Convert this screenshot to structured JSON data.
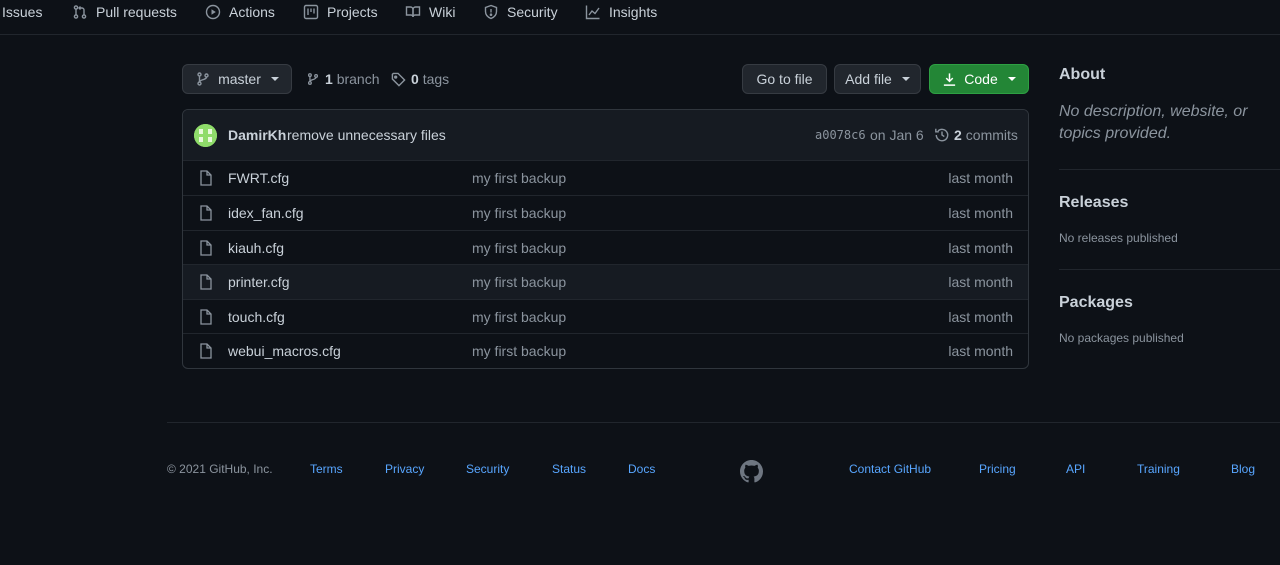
{
  "nav": {
    "items": [
      {
        "label": "Issues",
        "icon": "issues-icon"
      },
      {
        "label": "Pull requests",
        "icon": "pull-request-icon"
      },
      {
        "label": "Actions",
        "icon": "play-icon"
      },
      {
        "label": "Projects",
        "icon": "project-icon"
      },
      {
        "label": "Wiki",
        "icon": "book-icon"
      },
      {
        "label": "Security",
        "icon": "shield-icon"
      },
      {
        "label": "Insights",
        "icon": "graph-icon"
      }
    ]
  },
  "repo": {
    "branch_button": "master",
    "branch_count": "1",
    "branch_label": "branch",
    "tag_count": "0",
    "tag_label": "tags",
    "go_to_file": "Go to file",
    "add_file": "Add file",
    "code": "Code"
  },
  "commit": {
    "author": "DamirKh",
    "message": "remove unnecessary files",
    "sha": "a0078c6",
    "date": "on Jan 6",
    "count": "2",
    "count_label": "commits"
  },
  "files": [
    {
      "name": "FWRT.cfg",
      "message": "my first backup",
      "age": "last month"
    },
    {
      "name": "idex_fan.cfg",
      "message": "my first backup",
      "age": "last month"
    },
    {
      "name": "kiauh.cfg",
      "message": "my first backup",
      "age": "last month"
    },
    {
      "name": "printer.cfg",
      "message": "my first backup",
      "age": "last month"
    },
    {
      "name": "touch.cfg",
      "message": "my first backup",
      "age": "last month"
    },
    {
      "name": "webui_macros.cfg",
      "message": "my first backup",
      "age": "last month"
    }
  ],
  "sidebar": {
    "about_title": "About",
    "about_desc": "No description, website, or topics provided.",
    "releases_title": "Releases",
    "releases_text": "No releases published",
    "packages_title": "Packages",
    "packages_text": "No packages published"
  },
  "footer": {
    "copyright": "© 2021 GitHub, Inc.",
    "links_left": [
      "Terms",
      "Privacy",
      "Security",
      "Status",
      "Docs"
    ],
    "links_right": [
      "Contact GitHub",
      "Pricing",
      "API",
      "Training",
      "Blog"
    ]
  },
  "colors": {
    "background": "#0d1117",
    "accent_green": "#238636",
    "link_blue": "#58a6ff"
  }
}
